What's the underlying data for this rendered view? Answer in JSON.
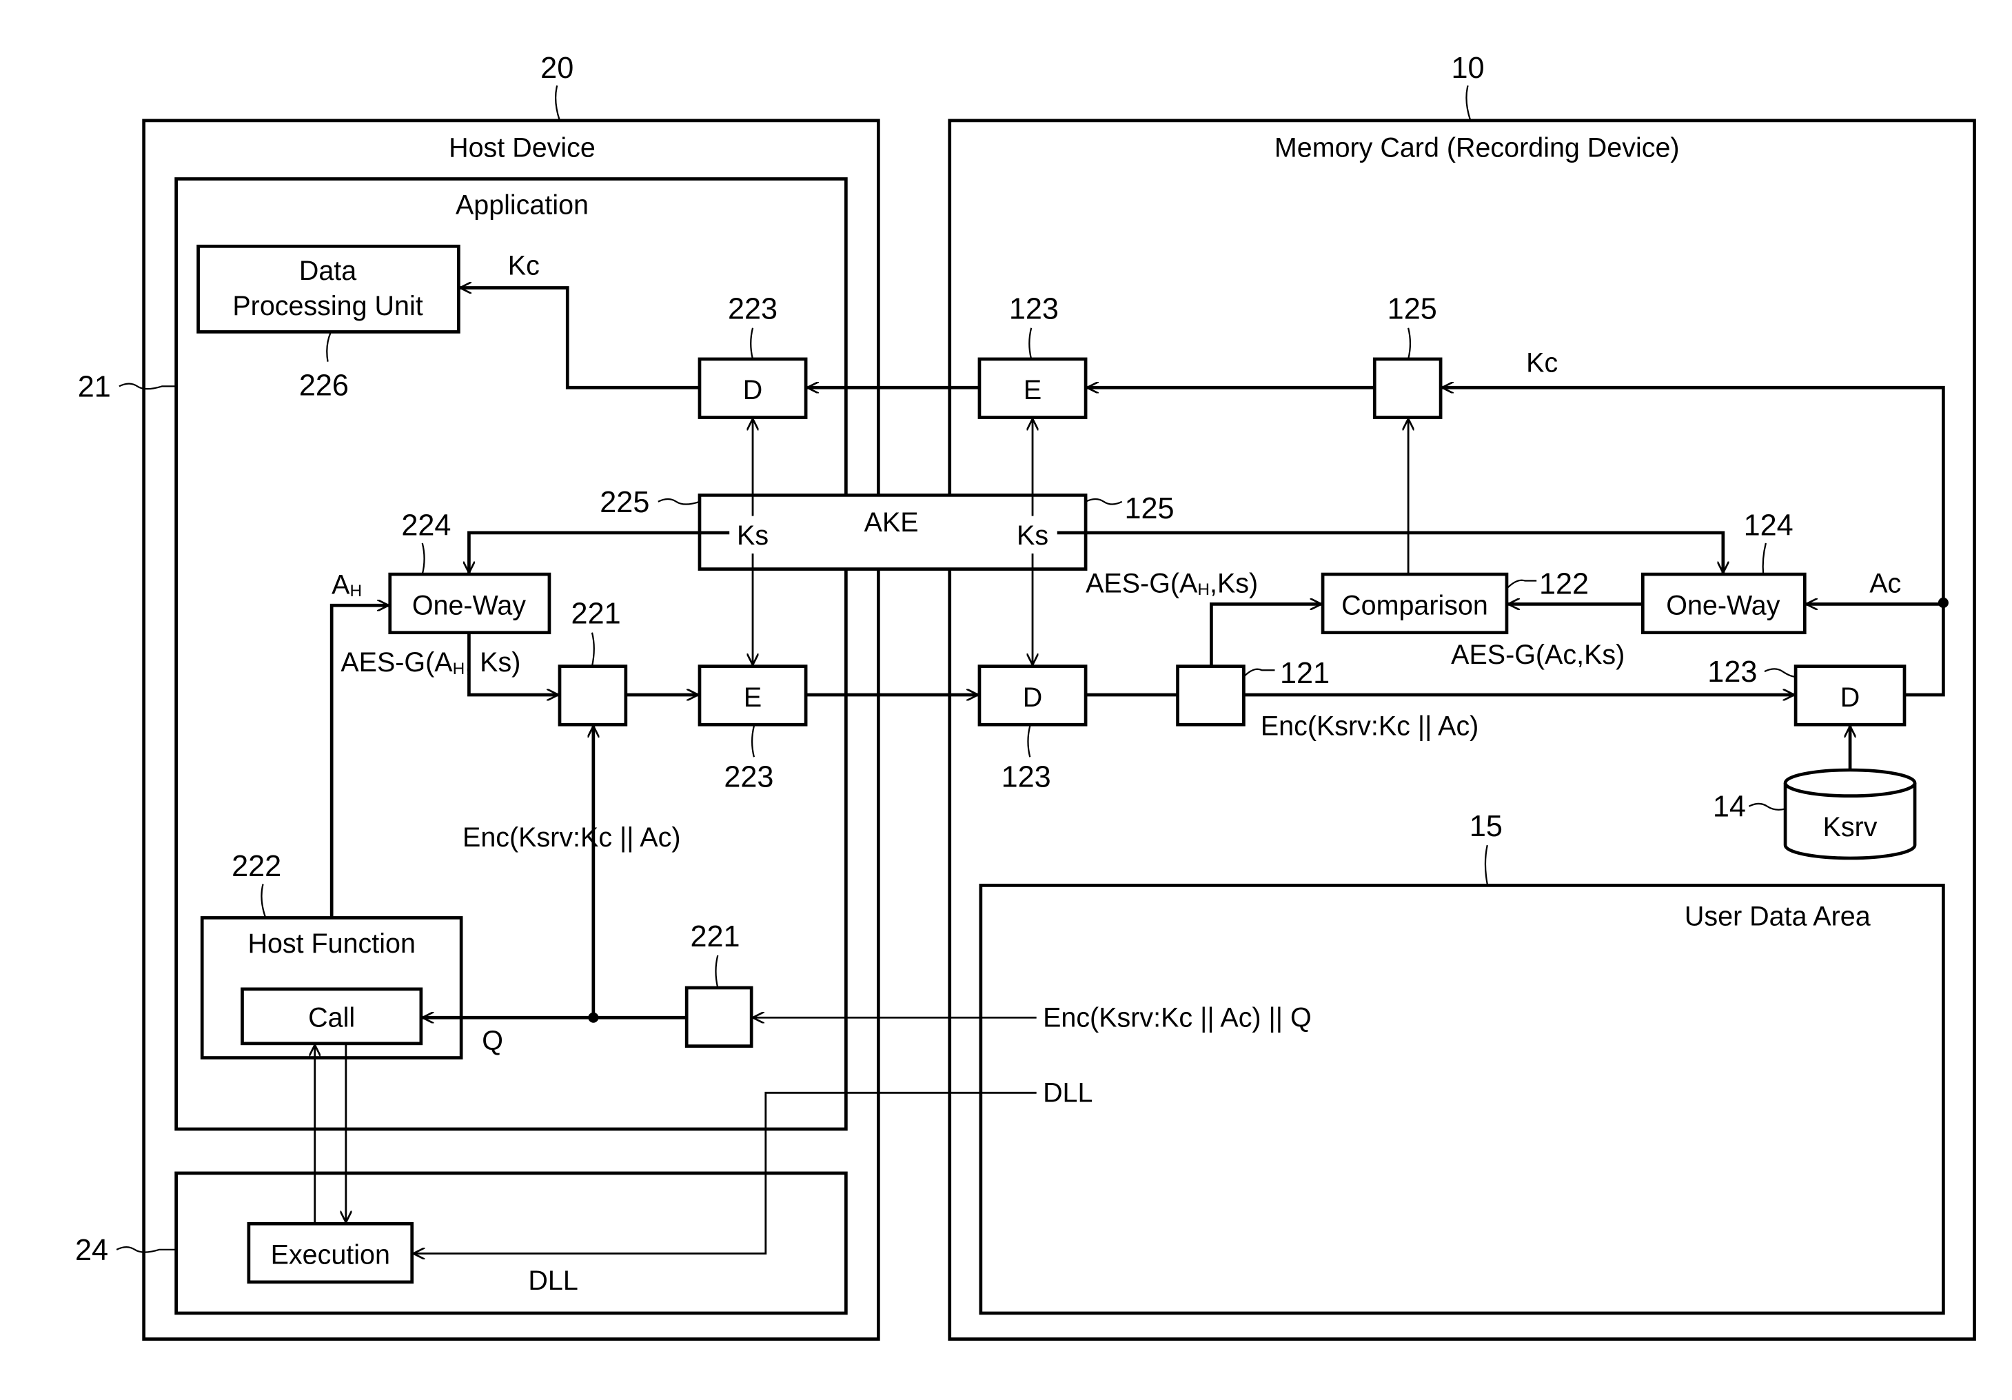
{
  "diagram": {
    "host": {
      "ref": "20",
      "title": "Host Device",
      "application_ref": "21",
      "application_title": "Application",
      "dll_area_ref": "24",
      "dll_area_label": "DLL",
      "data_processing_unit": {
        "line1": "Data",
        "line2": "Processing Unit",
        "ref": "226"
      },
      "decrypt_D": {
        "label": "D",
        "ref": "223"
      },
      "encrypt_E": {
        "label": "E",
        "ref": "223"
      },
      "ake": {
        "ref": "225"
      },
      "one_way": {
        "label": "One-Way",
        "ref": "224"
      },
      "selector_top_ref": "221",
      "selector_bottom_ref": "221",
      "host_function": {
        "label": "Host Function",
        "ref": "222",
        "call_label": "Call"
      },
      "execution_label": "Execution"
    },
    "card": {
      "ref": "10",
      "title": "Memory Card (Recording Device)",
      "encrypt_E": {
        "label": "E",
        "ref": "123"
      },
      "decrypt_D": {
        "label": "D",
        "ref": "123"
      },
      "decrypt_D2": {
        "label": "D",
        "ref": "123"
      },
      "selector_ref": "125",
      "ake_ref": "125",
      "comparison": {
        "label": "Comparison",
        "ref": "122"
      },
      "one_way": {
        "label": "One-Way",
        "ref": "124"
      },
      "splitter_ref": "121",
      "ksrv_store": {
        "label": "Ksrv",
        "ref": "14"
      },
      "user_data_area": {
        "label": "User Data Area",
        "ref": "15"
      }
    },
    "ake_label": "AKE",
    "signals": {
      "kc_host": "Kc",
      "kc_card": "Kc",
      "ks_left": "Ks",
      "ks_right": "Ks",
      "ah": "A",
      "ah_sub": "H",
      "aes_host_pre": "AES-G(A",
      "aes_host_sub": "H",
      "aes_host_post": ", Ks)",
      "aes_card_h_pre": "AES-G(A",
      "aes_card_h_sub": "H",
      "aes_card_h_post": ",Ks)",
      "aes_card_c": "AES-G(Ac,Ks)",
      "ac": "Ac",
      "enc_card": "Enc(Ksrv:Kc || Ac)",
      "enc_host": "Enc(Ksrv:Kc || Ac)",
      "enc_q": "Enc(Ksrv:Kc || Ac) || Q",
      "q": "Q",
      "dll_card": "DLL"
    }
  }
}
